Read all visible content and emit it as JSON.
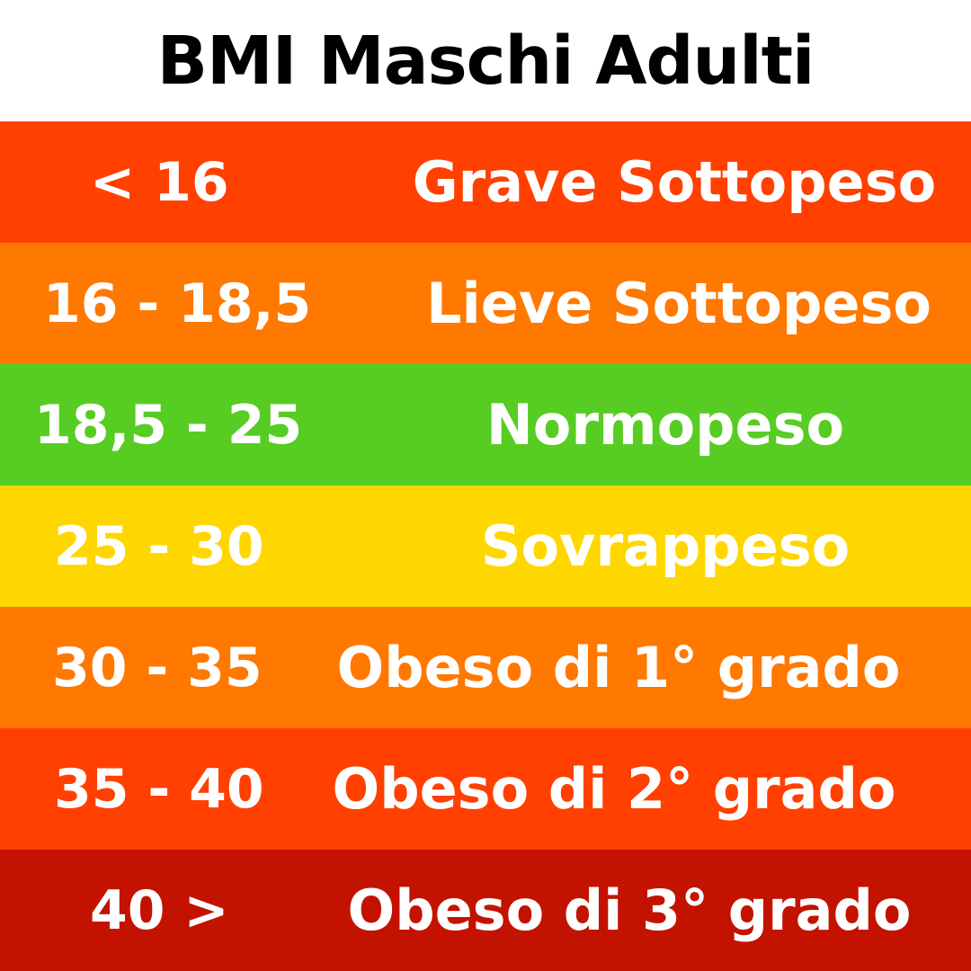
{
  "title": "BMI Maschi Adulti",
  "rows": [
    {
      "range": "< 16",
      "category": "Grave Sottopeso",
      "color": "#FF4000"
    },
    {
      "range": "16 - 18,5",
      "category": "Lieve Sottopeso",
      "color": "#FF7800"
    },
    {
      "range": "18,5 - 25",
      "category": "Normopeso",
      "color": "#57CC22"
    },
    {
      "range": "25 - 30",
      "category": "Sovrappeso",
      "color": "#FFD700"
    },
    {
      "range": "30 - 35",
      "category": "Obeso di 1° grado",
      "color": "#FF7800"
    },
    {
      "range": "35 - 40",
      "category": "Obeso di 2° grado",
      "color": "#FF4000"
    },
    {
      "range": "40 >",
      "category": "Obeso di 3° grado",
      "color": "#C41200"
    }
  ]
}
